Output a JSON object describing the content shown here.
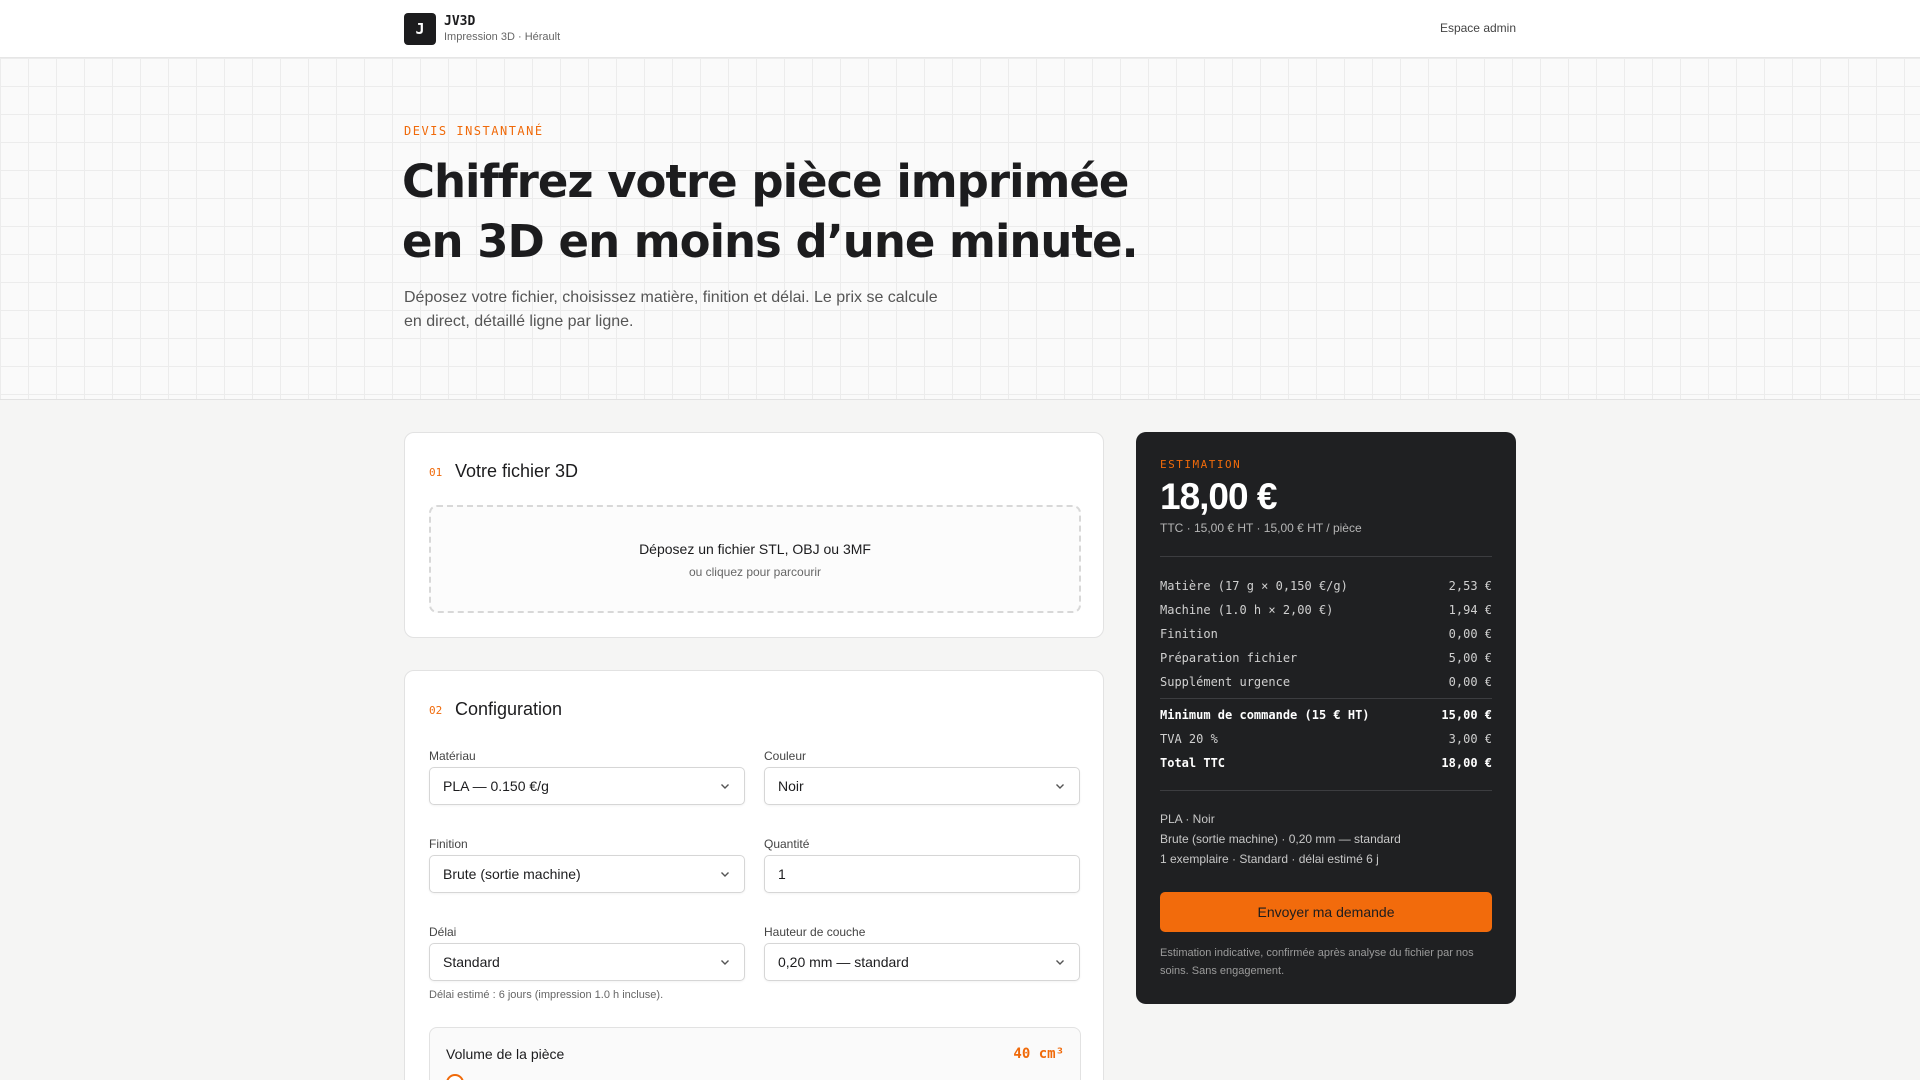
{
  "header": {
    "logo_letter": "J",
    "brand_name": "JV3D",
    "brand_sub": "Impression 3D · Hérault",
    "admin_link": "Espace admin"
  },
  "hero": {
    "eyebrow": "DEVIS INSTANTANÉ",
    "title_line1": "Chiffrez votre pièce imprimée",
    "title_line2": "en 3D en moins d’une minute.",
    "desc_line1": "Déposez votre fichier, choisissez matière, finition et délai. Le prix se calcule",
    "desc_line2": "en direct, détaillé ligne par ligne."
  },
  "file_section": {
    "step": "01",
    "title": "Votre fichier 3D",
    "dropzone_main": "Déposez un fichier STL, OBJ ou 3MF",
    "dropzone_sub": "ou cliquez pour parcourir"
  },
  "config_section": {
    "step": "02",
    "title": "Configuration",
    "material": {
      "label": "Matériau",
      "value": "PLA — 0.150 €/g"
    },
    "color": {
      "label": "Couleur",
      "value": "Noir"
    },
    "finish": {
      "label": "Finition",
      "value": "Brute (sortie machine)"
    },
    "quantity": {
      "label": "Quantité",
      "value": "1"
    },
    "delay": {
      "label": "Délai",
      "value": "Standard"
    },
    "layer": {
      "label": "Hauteur de couche",
      "value": "0,20 mm — standard"
    },
    "hint": "Délai estimé : 6 jours (impression 1.0 h incluse).",
    "volume": {
      "label": "Volume de la pièce",
      "value": "40 cm³"
    }
  },
  "estimate": {
    "eyebrow": "ESTIMATION",
    "price": "18,00 €",
    "sub": "TTC · 15,00 € HT · 15,00 € HT / pièce",
    "lines": [
      {
        "label": "Matière (17 g × 0,150 €/g)",
        "value": "2,53 €"
      },
      {
        "label": "Machine (1.0 h × 2,00 €)",
        "value": "1,94 €"
      },
      {
        "label": "Finition",
        "value": "0,00 €"
      },
      {
        "label": "Préparation fichier",
        "value": "5,00 €"
      },
      {
        "label": "Supplément urgence",
        "value": "0,00 €"
      }
    ],
    "totals": [
      {
        "label": "Minimum de commande (15 € HT)",
        "value": "15,00 €"
      },
      {
        "label": "TVA 20 %",
        "value": "3,00 €"
      },
      {
        "label": "Total TTC",
        "value": "18,00 €"
      }
    ],
    "meta": [
      "PLA · Noir",
      "Brute (sortie machine) · 0,20 mm — standard",
      "1 exemplaire · Standard · délai estimé 6 j"
    ],
    "button": "Envoyer ma demande",
    "disclaimer": "Estimation indicative, confirmée après analyse du fichier par nos soins. Sans engagement."
  },
  "colors": {
    "accent": "#f06a0a",
    "dark_panel": "#1f2022"
  }
}
